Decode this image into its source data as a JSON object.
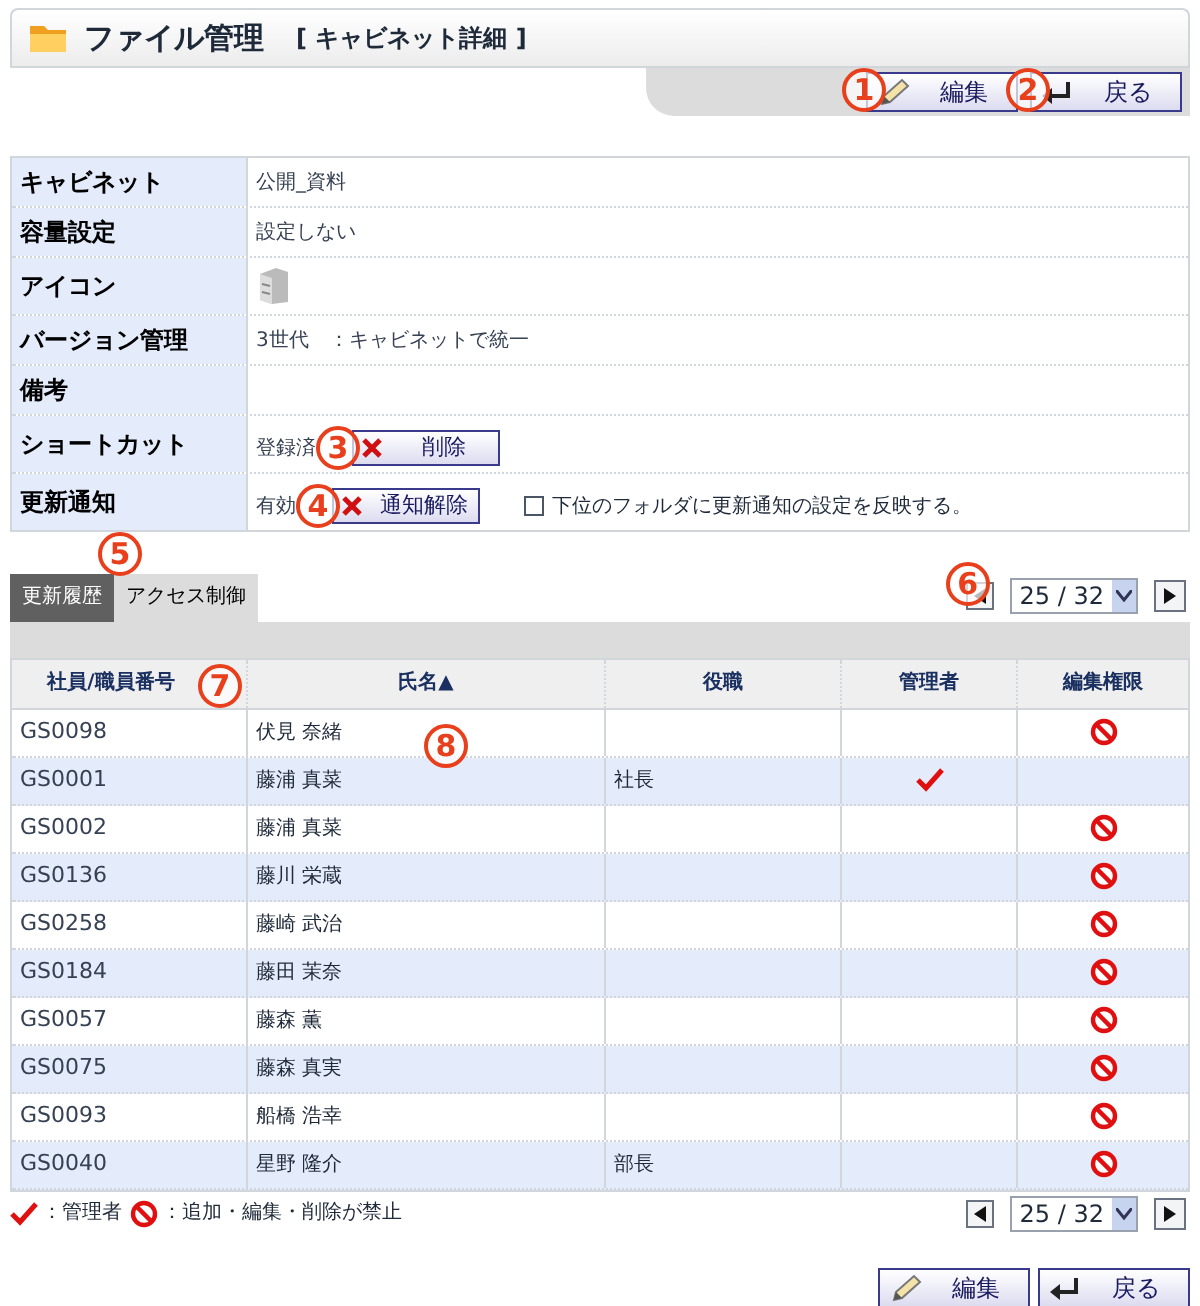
{
  "header": {
    "title": "ファイル管理",
    "subtitle": "[ キャビネット詳細 ]"
  },
  "top_buttons": [
    {
      "kind": "edit",
      "label": "編集",
      "callout": "1"
    },
    {
      "kind": "back",
      "label": "戻る",
      "callout": "2"
    }
  ],
  "details": [
    {
      "label": "キャビネット",
      "kind": "text",
      "value": "公開_資料"
    },
    {
      "label": "容量設定",
      "kind": "text",
      "value": "設定しない"
    },
    {
      "label": "アイコン",
      "kind": "icon"
    },
    {
      "label": "バージョン管理",
      "kind": "text",
      "value": "3世代　：キャビネットで統一"
    },
    {
      "label": "備考",
      "kind": "empty"
    },
    {
      "label": "ショートカット",
      "kind": "action",
      "status": "登録済",
      "button": "削除",
      "callout": "3"
    },
    {
      "label": "更新通知",
      "kind": "action",
      "status": "有効",
      "button": "通知解除",
      "callout": "4",
      "checkbox": {
        "label": "下位のフォルダに更新通知の設定を反映する。",
        "checked": false
      }
    }
  ],
  "tabs": [
    {
      "label": "更新履歴",
      "selected": false
    },
    {
      "label": "アクセス制御",
      "selected": true,
      "callout": "5"
    }
  ],
  "pager_top": {
    "value": "25 / 32",
    "callout": "6"
  },
  "table": {
    "callout": "8",
    "columns": [
      {
        "label": "社員/職員番号",
        "callout": "7"
      },
      {
        "label": "氏名▲"
      },
      {
        "label": "役職"
      },
      {
        "label": "管理者"
      },
      {
        "label": "編集権限"
      }
    ],
    "rows": [
      {
        "id": "GS0098",
        "name": "伏見 奈緒",
        "title": "",
        "admin": false,
        "denied": true
      },
      {
        "id": "GS0001",
        "name": "藤浦 真菜",
        "title": "社長",
        "admin": true,
        "denied": false
      },
      {
        "id": "GS0002",
        "name": "藤浦 真菜",
        "title": "",
        "admin": false,
        "denied": true
      },
      {
        "id": "GS0136",
        "name": "藤川 栄蔵",
        "title": "",
        "admin": false,
        "denied": true
      },
      {
        "id": "GS0258",
        "name": "藤崎 武治",
        "title": "",
        "admin": false,
        "denied": true
      },
      {
        "id": "GS0184",
        "name": "藤田 茉奈",
        "title": "",
        "admin": false,
        "denied": true
      },
      {
        "id": "GS0057",
        "name": "藤森 薫",
        "title": "",
        "admin": false,
        "denied": true
      },
      {
        "id": "GS0075",
        "name": "藤森 真実",
        "title": "",
        "admin": false,
        "denied": true
      },
      {
        "id": "GS0093",
        "name": "船橋 浩幸",
        "title": "",
        "admin": false,
        "denied": true
      },
      {
        "id": "GS0040",
        "name": "星野 隆介",
        "title": "部長",
        "admin": false,
        "denied": true
      }
    ]
  },
  "legend": [
    {
      "kind": "admin",
      "text": "：管理者"
    },
    {
      "kind": "denied",
      "text": "：追加・編集・削除が禁止"
    }
  ],
  "pager_bottom": {
    "value": "25 / 32"
  },
  "bottom_buttons": [
    {
      "kind": "edit",
      "label": "編集"
    },
    {
      "kind": "back",
      "label": "戻る"
    }
  ]
}
